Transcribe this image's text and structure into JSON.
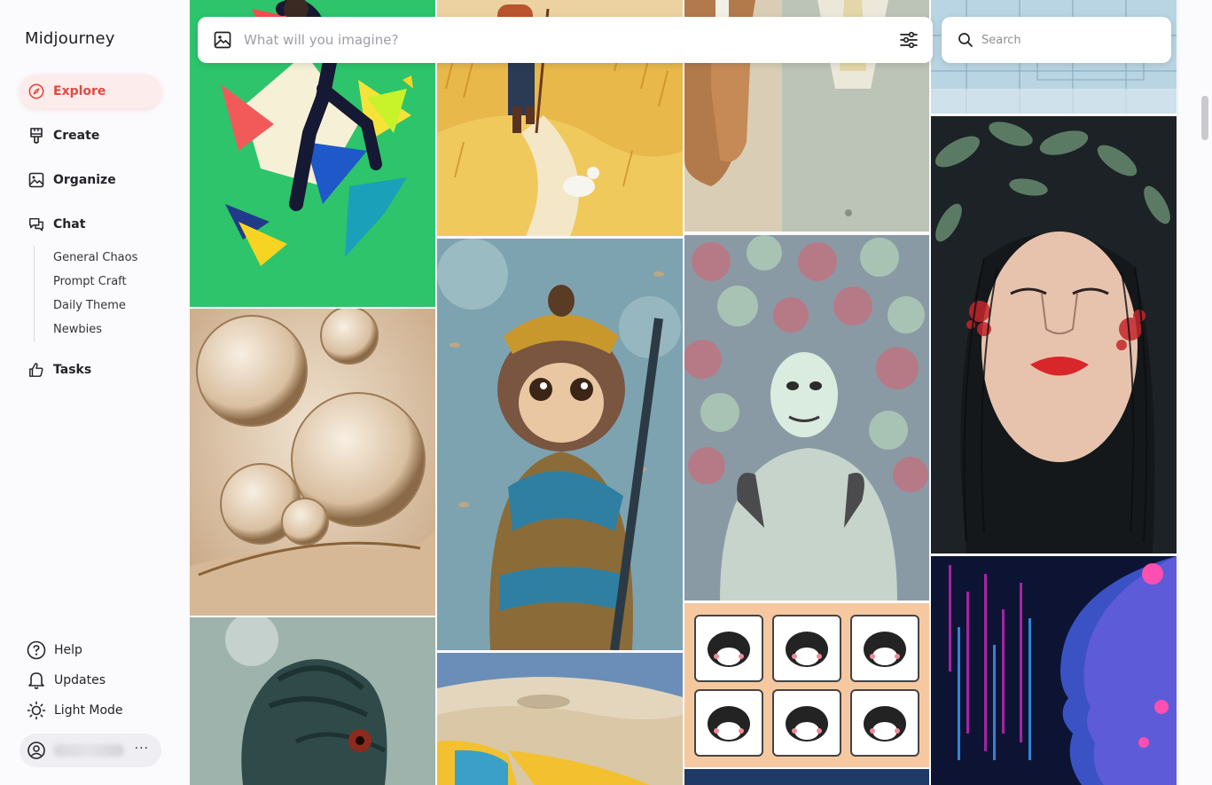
{
  "app": {
    "title": "Midjourney"
  },
  "nav": {
    "explore": "Explore",
    "create": "Create",
    "organize": "Organize",
    "chat": "Chat",
    "tasks": "Tasks"
  },
  "chat_rooms": [
    "General Chaos",
    "Prompt Craft",
    "Daily Theme",
    "Newbies"
  ],
  "bottom": {
    "help": "Help",
    "updates": "Updates",
    "light_mode": "Light Mode",
    "more": "···"
  },
  "imagine": {
    "placeholder": "What will you imagine?"
  },
  "search": {
    "placeholder": "Search"
  },
  "colors": {
    "accent": "#e04a3f",
    "active_bg": "#fdecec"
  },
  "gallery": [
    {
      "name": "gallery-image-abstract-climber",
      "desc": "colorful geometric climber"
    },
    {
      "name": "gallery-image-hiker-wheat",
      "desc": "hiker in wheat field"
    },
    {
      "name": "gallery-image-horse-suit",
      "desc": "horse and suit"
    },
    {
      "name": "gallery-image-blueprint",
      "desc": "blueprint"
    },
    {
      "name": "gallery-image-bubbles",
      "desc": "liquid bubbles"
    },
    {
      "name": "gallery-image-monkey-warrior",
      "desc": "monkey warrior"
    },
    {
      "name": "gallery-image-masked-figure",
      "desc": "masked figure with balloons"
    },
    {
      "name": "gallery-image-woman-leaves",
      "desc": "woman with leaves"
    },
    {
      "name": "gallery-image-creature",
      "desc": "horned creature"
    },
    {
      "name": "gallery-image-sunglasses-sand",
      "desc": "sunglasses in sand"
    },
    {
      "name": "gallery-image-cat-stickers",
      "desc": "cat stickers grid"
    },
    {
      "name": "gallery-image-neon-face",
      "desc": "neon digital face"
    }
  ]
}
